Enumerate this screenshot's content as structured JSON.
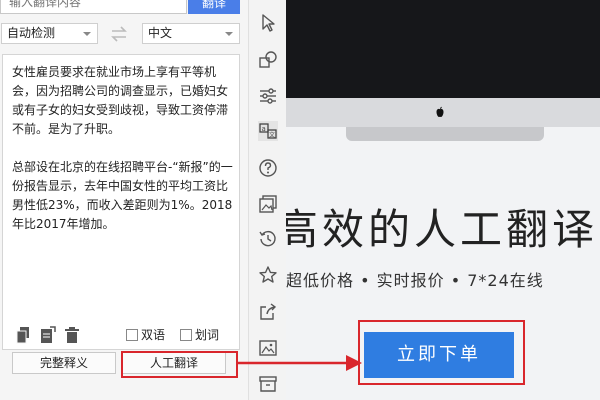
{
  "search": {
    "placeholder": "输入翻译内容",
    "translate_label": "翻译"
  },
  "languages": {
    "source": "自动检测",
    "target": "中文"
  },
  "source_text": "女性雇员要求在就业市场上享有平等机会，因为招聘公司的调查显示，已婚妇女或有子女的妇女受到歧视，导致工资停滞不前。是为了升职。\n\n总部设在北京的在线招聘平台-“新报”的一份报告显示，去年中国女性的平均工资比男性低23%，而收入差距则为1%。2018年比2017年增加。",
  "tools": {
    "bilingual_label": "双语",
    "markup_label": "划词"
  },
  "buttons": {
    "full_definition": "完整释义",
    "human_translation": "人工翻译"
  },
  "toolbar_icons": [
    "cursor-icon",
    "shapes-icon",
    "sliders-icon",
    "translate-icon",
    "help-icon",
    "images-icon",
    "history-icon",
    "star-icon",
    "share-icon",
    "image-icon",
    "archive-icon"
  ],
  "promo": {
    "headline": "高效的人工翻译",
    "tagline": "超低价格 • 实时报价 • 7*24在线",
    "order_button": "立即下单"
  },
  "colors": {
    "accent": "#2f7de1",
    "highlight": "#d9262c",
    "translate_button": "#4a7ee8"
  }
}
